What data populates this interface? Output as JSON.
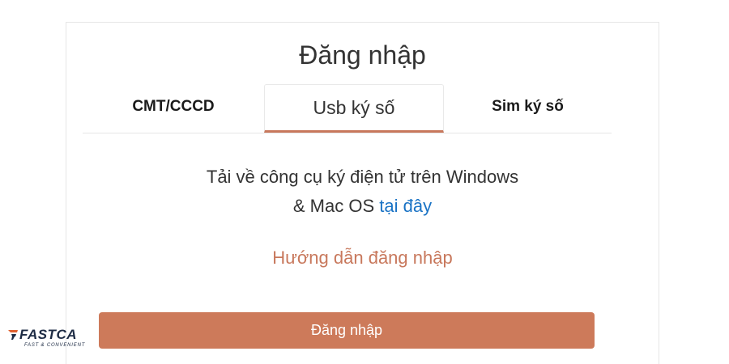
{
  "login": {
    "title": "Đăng nhập",
    "tabs": [
      {
        "label": "CMT/CCCD"
      },
      {
        "label": "Usb ký số"
      },
      {
        "label": "Sim ký số"
      }
    ],
    "info_line1": "Tải về công cụ ký điện tử trên Windows",
    "info_line2_prefix": "& Mac OS",
    "info_link": "tại đây",
    "guide_link": "Hướng dẫn đăng nhập",
    "submit_label": "Đăng nhập"
  },
  "logo": {
    "name": "FASTCA",
    "tagline": "FAST & CONVENIENT"
  },
  "colors": {
    "accent": "#cd7a5a",
    "link": "#1a73c5",
    "text": "#333333"
  }
}
